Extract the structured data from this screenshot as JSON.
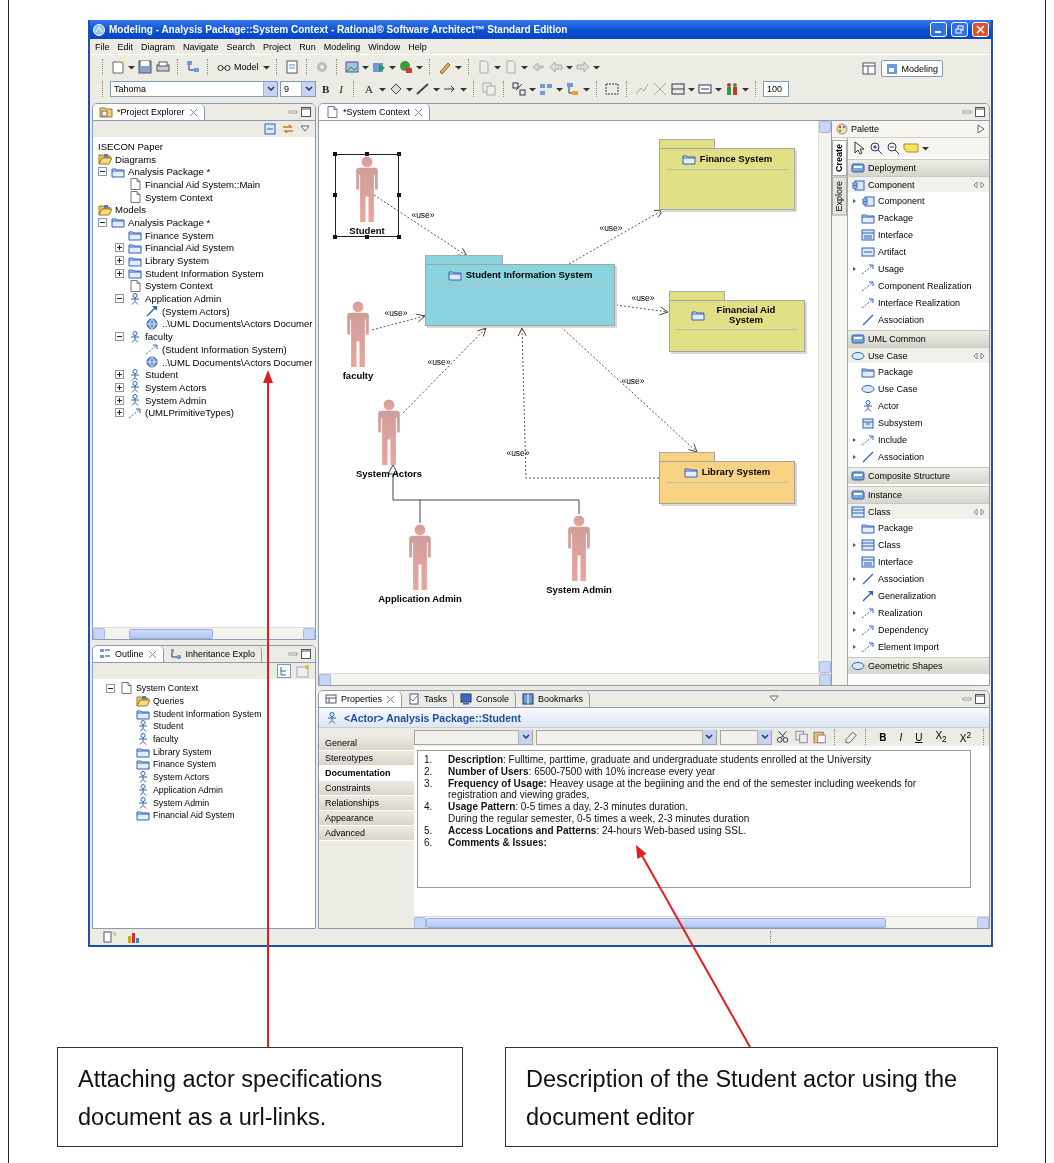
{
  "window": {
    "title": "Modeling - Analysis Package::System Context - Rational® Software Architect™ Standard Edition"
  },
  "menu": [
    "File",
    "Edit",
    "Diagram",
    "Navigate",
    "Search",
    "Project",
    "Run",
    "Modeling",
    "Window",
    "Help"
  ],
  "toolbar": {
    "model_button": "Model",
    "perspective": "Modeling",
    "font": "Tahoma",
    "size": "9",
    "bold": "B",
    "italic": "I",
    "font_color": "A",
    "zoom": "100"
  },
  "project_explorer": {
    "tab": {
      "label": "*Project Explorer",
      "selected": true
    },
    "tree": [
      {
        "label": "ISECON Paper",
        "kind": "project"
      },
      {
        "label": "Diagrams",
        "kind": "open_folder",
        "children": [
          {
            "label": "Analysis Package *",
            "kind": "package",
            "expanded": true,
            "children": [
              {
                "label": "Financial Aid System::Main",
                "kind": "diagram"
              },
              {
                "label": "System Context",
                "kind": "diagram"
              }
            ]
          }
        ]
      },
      {
        "label": "Models",
        "kind": "open_folder",
        "children": [
          {
            "label": "Analysis Package *",
            "kind": "package",
            "expanded": true,
            "children": [
              {
                "label": "Finance System",
                "kind": "package"
              },
              {
                "label": "Financial Aid System",
                "kind": "package",
                "expanded": false
              },
              {
                "label": "Library System",
                "kind": "package",
                "expanded": false
              },
              {
                "label": "Student Information System",
                "kind": "package",
                "expanded": false
              },
              {
                "label": "System Context",
                "kind": "diagram"
              },
              {
                "label": "Application Admin",
                "kind": "actor",
                "expanded": true,
                "children": [
                  {
                    "label": "(System Actors)",
                    "kind": "generalization"
                  },
                  {
                    "label": "..\\UML Documents\\Actors Documer",
                    "kind": "url"
                  }
                ]
              },
              {
                "label": "faculty",
                "kind": "actor",
                "expanded": true,
                "children": [
                  {
                    "label": "(Student Information System)",
                    "kind": "usage"
                  },
                  {
                    "label": "..\\UML Documents\\Actors Documer",
                    "kind": "url"
                  }
                ]
              },
              {
                "label": "Student",
                "kind": "actor",
                "expanded": false
              },
              {
                "label": "System Actors",
                "kind": "actor",
                "expanded": false
              },
              {
                "label": "System Admin",
                "kind": "actor",
                "expanded": false
              },
              {
                "label": "(UMLPrimitiveTypes)",
                "kind": "primitives",
                "expanded": false
              }
            ]
          }
        ]
      }
    ]
  },
  "outline": {
    "tabs": [
      {
        "label": "Outline",
        "selected": true
      },
      {
        "label": "Inheritance Explo",
        "selected": false
      }
    ],
    "tree": [
      {
        "label": "System Context",
        "kind": "diagram",
        "expanded": true,
        "children": [
          {
            "label": "Queries",
            "kind": "open_folder"
          },
          {
            "label": "Student Information System",
            "kind": "package"
          },
          {
            "label": "Student",
            "kind": "actor"
          },
          {
            "label": "faculty",
            "kind": "actor"
          },
          {
            "label": "Library System",
            "kind": "package"
          },
          {
            "label": "Finance System",
            "kind": "package"
          },
          {
            "label": "System Actors",
            "kind": "actor"
          },
          {
            "label": "Application Admin",
            "kind": "actor"
          },
          {
            "label": "System Admin",
            "kind": "actor"
          },
          {
            "label": "Financial Aid System",
            "kind": "package"
          }
        ]
      }
    ]
  },
  "editor": {
    "tab": {
      "label": "*System Context",
      "selected": true
    },
    "diagram": {
      "actors": [
        {
          "name": "Student",
          "selected": true
        },
        {
          "name": "faculty",
          "selected": false
        },
        {
          "name": "System Actors",
          "selected": false
        },
        {
          "name": "Application Admin",
          "selected": false
        },
        {
          "name": "System Admin",
          "selected": false
        }
      ],
      "packages": [
        {
          "name": "Finance System",
          "color": "#e2e084"
        },
        {
          "name": "Student Information System",
          "color": "#8ad4e0"
        },
        {
          "name": "Financial Aid System",
          "color": "#e2e084"
        },
        {
          "name": "Library System",
          "color": "#f9d282"
        }
      ],
      "connectors": [
        {
          "kind": "use",
          "label": "«use»"
        },
        {
          "kind": "use",
          "label": "«use»"
        },
        {
          "kind": "use",
          "label": "«use»"
        },
        {
          "kind": "use",
          "label": "«use»"
        },
        {
          "kind": "use",
          "label": "«use»"
        },
        {
          "kind": "use",
          "label": "«use»"
        },
        {
          "kind": "use",
          "label": "«use»"
        },
        {
          "kind": "generalization"
        }
      ]
    }
  },
  "palette": {
    "title": "Palette",
    "tabs": [
      {
        "label": "Create",
        "selected": true
      },
      {
        "label": "Explore",
        "selected": false
      }
    ],
    "sections": [
      {
        "label": "Deployment",
        "kind": "drawer",
        "expanded": false
      },
      {
        "label": "Component",
        "kind": "stack",
        "expanded": true,
        "items": [
          {
            "label": "Component",
            "kind": "component",
            "submenu": true
          },
          {
            "label": "Package",
            "kind": "package",
            "submenu": false
          },
          {
            "label": "Interface",
            "kind": "interface",
            "submenu": false
          },
          {
            "label": "Artifact",
            "kind": "artifact",
            "submenu": false
          },
          {
            "label": "Usage",
            "kind": "usage",
            "submenu": true
          },
          {
            "label": "Component Realization",
            "kind": "realization",
            "submenu": false
          },
          {
            "label": "Interface Realization",
            "kind": "realization",
            "submenu": false
          },
          {
            "label": "Association",
            "kind": "association",
            "submenu": false
          }
        ]
      },
      {
        "label": "UML Common",
        "kind": "drawer",
        "expanded": false
      },
      {
        "label": "Use Case",
        "kind": "stack",
        "expanded": true,
        "items": [
          {
            "label": "Package",
            "kind": "package",
            "submenu": false
          },
          {
            "label": "Use Case",
            "kind": "usecase",
            "submenu": false
          },
          {
            "label": "Actor",
            "kind": "actor",
            "submenu": false
          },
          {
            "label": "Subsystem",
            "kind": "subsystem",
            "submenu": false
          },
          {
            "label": "Include",
            "kind": "include",
            "submenu": true
          },
          {
            "label": "Association",
            "kind": "association",
            "submenu": true
          }
        ]
      },
      {
        "label": "Composite Structure",
        "kind": "drawer",
        "expanded": false
      },
      {
        "label": "Instance",
        "kind": "drawer",
        "expanded": false
      },
      {
        "label": "Class",
        "kind": "stack",
        "expanded": true,
        "items": [
          {
            "label": "Package",
            "kind": "package",
            "submenu": false
          },
          {
            "label": "Class",
            "kind": "class",
            "submenu": true
          },
          {
            "label": "Interface",
            "kind": "interface",
            "submenu": false
          },
          {
            "label": "Association",
            "kind": "association",
            "submenu": true
          },
          {
            "label": "Generalization",
            "kind": "generalization",
            "submenu": false
          },
          {
            "label": "Realization",
            "kind": "realization",
            "submenu": true
          },
          {
            "label": "Dependency",
            "kind": "dependency",
            "submenu": true
          },
          {
            "label": "Element Import",
            "kind": "import",
            "submenu": true
          }
        ]
      },
      {
        "label": "Geometric Shapes",
        "kind": "drawer",
        "expanded": false
      }
    ]
  },
  "properties": {
    "tabs": [
      {
        "label": "Properties",
        "selected": true
      },
      {
        "label": "Tasks",
        "selected": false
      },
      {
        "label": "Console",
        "selected": false
      },
      {
        "label": "Bookmarks",
        "selected": false
      }
    ],
    "title": "<Actor> Analysis Package::Student",
    "sections": [
      {
        "label": "General",
        "selected": false
      },
      {
        "label": "Stereotypes",
        "selected": false
      },
      {
        "label": "Documentation",
        "selected": true
      },
      {
        "label": "Constraints",
        "selected": false
      },
      {
        "label": "Relationships",
        "selected": false
      },
      {
        "label": "Appearance",
        "selected": false
      },
      {
        "label": "Advanced",
        "selected": false
      }
    ],
    "format_buttons": [
      {
        "label": "B",
        "kind": "bold"
      },
      {
        "label": "I",
        "kind": "italic"
      },
      {
        "label": "U",
        "kind": "underline"
      },
      {
        "label": "X$_{2}$",
        "kind": "subscript"
      },
      {
        "label": "X$^{2}$",
        "kind": "superscript"
      }
    ],
    "document": [
      {
        "number": "1.",
        "text": "**Description**: Fulltime, parttime, graduate and undergraduate students enrolled at the University"
      },
      {
        "number": "2.",
        "text": "**Number of Users**: 6500-7500 with 10% increase every year"
      },
      {
        "number": "3.",
        "text": "**Frequency of Usage:** Heavey usage at the begiining and the end of the semester including weekends for registration and viewing grades,"
      },
      {
        "number": "4.",
        "text": "**Usage Pattern**: 0-5 times a day, 2-3 minutes duration.",
        "continuation": "During the regular semester, 0-5 times a week, 2-3 minutes duration"
      },
      {
        "number": "5.",
        "text": "**Access Locations and Patterns**: 24-hours Web-based using SSL."
      },
      {
        "number": "6.",
        "text": "**Comments & Issues:**"
      }
    ]
  },
  "callouts": [
    {
      "text": "Attaching actor specifications document as a url-links."
    },
    {
      "text": "Description of the Student actor using the document editor"
    }
  ]
}
